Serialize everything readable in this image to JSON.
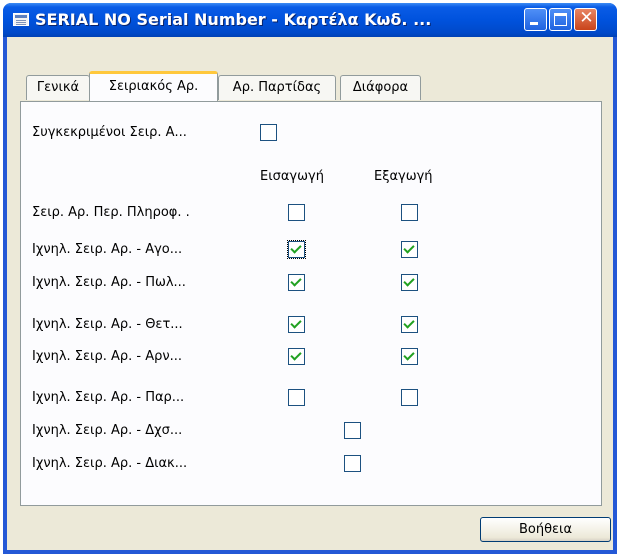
{
  "window": {
    "title": "SERIAL NO Serial Number - Καρτέλα Κωδ. ..."
  },
  "tabs": [
    {
      "label": "Γενικά",
      "active": false
    },
    {
      "label": "Σειριακός Αρ.",
      "active": true
    },
    {
      "label": "Αρ. Παρτίδας",
      "active": false
    },
    {
      "label": "Διάφορα",
      "active": false
    }
  ],
  "form": {
    "specific_label": "Συγκεκριμένοι Σειρ. Α...",
    "col_inbound": "Εισαγωγή",
    "col_outbound": "Εξαγωγή",
    "rows": [
      {
        "label": "Σειρ. Αρ. Περ. Πληροφ. .",
        "inbound": false,
        "outbound": false
      },
      {
        "label": "Ιχνηλ. Σειρ. Αρ. - Αγο...",
        "inbound": true,
        "outbound": true
      },
      {
        "label": "Ιχνηλ. Σειρ. Αρ. - Πωλ...",
        "inbound": true,
        "outbound": true
      },
      {
        "label": "Ιχνηλ. Σειρ. Αρ. - Θετ...",
        "inbound": true,
        "outbound": true
      },
      {
        "label": "Ιχνηλ. Σειρ. Αρ. - Αρν...",
        "inbound": true,
        "outbound": true
      },
      {
        "label": "Ιχνηλ. Σειρ. Αρ. - Παρ...",
        "inbound": false,
        "outbound": false
      },
      {
        "label": "Ιχνηλ. Σειρ. Αρ. - Δχσ...",
        "value": false
      },
      {
        "label": "Ιχνηλ. Σειρ. Αρ. - Διακ...",
        "value": false
      }
    ]
  },
  "help_button": "Βοήθεια"
}
